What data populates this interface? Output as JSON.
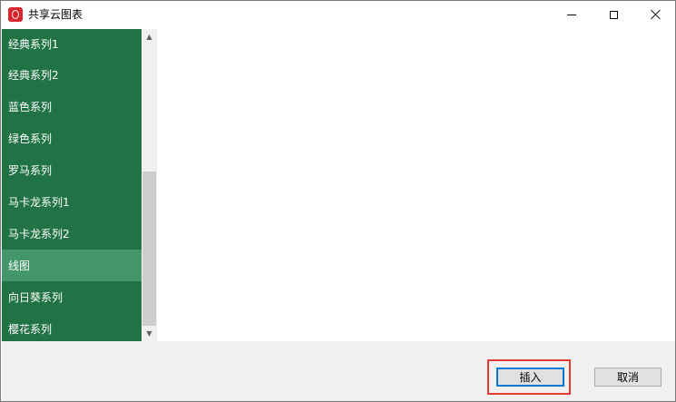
{
  "window": {
    "title": "共享云图表"
  },
  "sidebar": {
    "items": [
      {
        "label": "经典系列1"
      },
      {
        "label": "经典系列2"
      },
      {
        "label": "蓝色系列"
      },
      {
        "label": "绿色系列"
      },
      {
        "label": "罗马系列"
      },
      {
        "label": "马卡龙系列1"
      },
      {
        "label": "马卡龙系列2"
      },
      {
        "label": "线图",
        "selected": true
      },
      {
        "label": "向日葵系列"
      },
      {
        "label": "樱花系列"
      }
    ]
  },
  "scrollbar": {
    "up_glyph": "▲",
    "down_glyph": "▼"
  },
  "footer": {
    "insert_label": "插入",
    "cancel_label": "取消"
  },
  "colors": {
    "sidebar_bg": "#217346",
    "selected_bg": "#43966a",
    "highlight": "#e53935"
  }
}
